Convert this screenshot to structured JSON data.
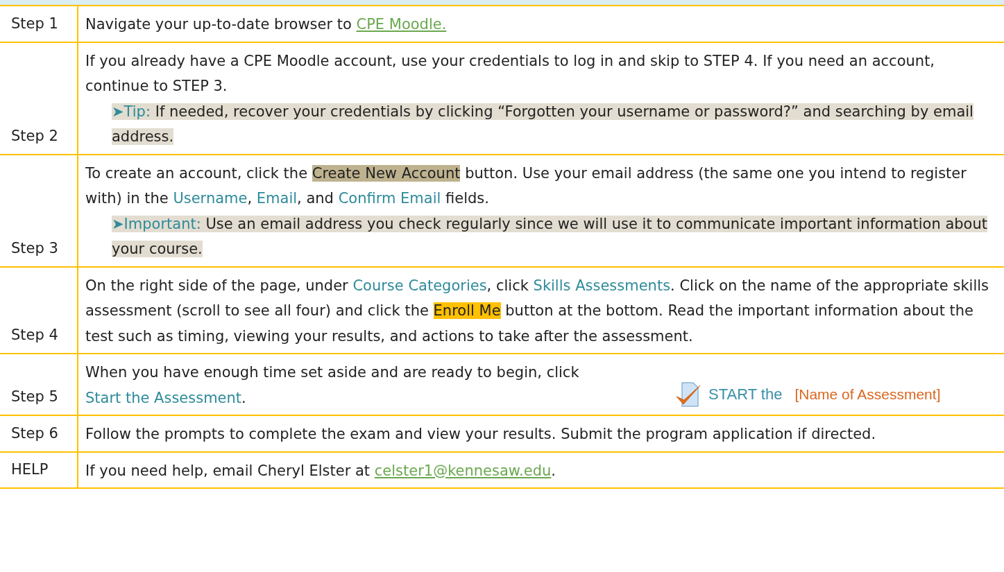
{
  "rows": [
    {
      "label": "Step 1",
      "paragraphs": [
        {
          "kind": "body",
          "segments": [
            {
              "kind": "text",
              "text": "Navigate your up-to-date browser to "
            },
            {
              "kind": "link",
              "text": "CPE Moodle."
            }
          ]
        }
      ]
    },
    {
      "label": "Step 2",
      "paragraphs": [
        {
          "kind": "body",
          "segments": [
            {
              "kind": "text",
              "text": "If you already have a CPE Moodle account, use your credentials to log in and skip to STEP 4. If you need an account, continue to STEP 3."
            }
          ]
        },
        {
          "kind": "tip",
          "segments": [
            {
              "kind": "term",
              "text": "➤Tip:"
            },
            {
              "kind": "text",
              "text": " If needed, recover your credentials by clicking “Forgotten your username or password?” and searching by email address."
            }
          ]
        }
      ]
    },
    {
      "label": "Step 3",
      "paragraphs": [
        {
          "kind": "body",
          "segments": [
            {
              "kind": "text",
              "text": "To create an account, click the "
            },
            {
              "kind": "highlight",
              "text": "Create New Account"
            },
            {
              "kind": "text",
              "text": " button. Use your email address (the same one you intend to register with) in the "
            },
            {
              "kind": "term",
              "text": "Username"
            },
            {
              "kind": "text",
              "text": ", "
            },
            {
              "kind": "term",
              "text": "Email"
            },
            {
              "kind": "text",
              "text": ", and "
            },
            {
              "kind": "term",
              "text": "Confirm Email"
            },
            {
              "kind": "text",
              "text": " fields."
            }
          ]
        },
        {
          "kind": "tip",
          "segments": [
            {
              "kind": "term",
              "text": "➤Important:"
            },
            {
              "kind": "text",
              "text": " Use an email address you check regularly since we will use it to communicate important information about your course."
            }
          ]
        }
      ]
    },
    {
      "label": "Step 4",
      "paragraphs": [
        {
          "kind": "body",
          "segments": [
            {
              "kind": "text",
              "text": "On the right side of the page, under "
            },
            {
              "kind": "term",
              "text": "Course Categories"
            },
            {
              "kind": "text",
              "text": ", click "
            },
            {
              "kind": "term",
              "text": "Skills Assessments"
            },
            {
              "kind": "text",
              "text": ". Click on the name of the appropriate skills assessment (scroll to see all four) and click the "
            },
            {
              "kind": "mark",
              "text": "Enroll Me"
            },
            {
              "kind": "text",
              "text": " button at the bottom. Read the important information about the test such as timing, viewing your results, and actions to take after the assessment."
            }
          ]
        }
      ]
    },
    {
      "label": "Step 5",
      "paragraphs": [
        {
          "kind": "body",
          "segments": [
            {
              "kind": "text",
              "text": "When you have enough time set aside and are ready to begin, click "
            },
            {
              "kind": "term",
              "text": "Start the Assessment"
            },
            {
              "kind": "text",
              "text": "."
            }
          ]
        }
      ],
      "figure": {
        "action": "START the",
        "name": "[Name of Assessment]"
      }
    },
    {
      "label": "Step 6",
      "paragraphs": [
        {
          "kind": "body",
          "segments": [
            {
              "kind": "text",
              "text": "Follow the prompts to complete the exam and view your results. Submit the program application if directed."
            }
          ]
        }
      ]
    },
    {
      "label": "HELP",
      "paragraphs": [
        {
          "kind": "body",
          "segments": [
            {
              "kind": "text",
              "text": "If you need help, email Cheryl Elster at "
            },
            {
              "kind": "link",
              "text": "celster1@kennesaw.edu"
            },
            {
              "kind": "text",
              "text": "."
            }
          ]
        }
      ]
    }
  ]
}
